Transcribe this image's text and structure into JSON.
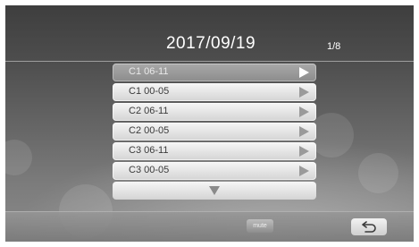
{
  "header": {
    "date_title": "2017/09/19",
    "page_indicator": "1/8"
  },
  "list": {
    "items": [
      {
        "label": "C1 06-11",
        "selected": true
      },
      {
        "label": "C1 00-05",
        "selected": false
      },
      {
        "label": "C2 06-11",
        "selected": false
      },
      {
        "label": "C2 00-05",
        "selected": false
      },
      {
        "label": "C3 06-11",
        "selected": false
      },
      {
        "label": "C3 00-05",
        "selected": false
      }
    ],
    "scroll_down_icon": "triangle-down-icon",
    "item_icon": "play-triangle-icon"
  },
  "toolbar": {
    "mini_button_label": "mute",
    "back_icon": "return-arrow-icon"
  },
  "colors": {
    "background_top": "#3e3e3e",
    "background_bottom": "#8a8a8a",
    "item_fill": "#e6e6e6",
    "item_selected_fill": "#999999",
    "title_text": "#ffffff"
  }
}
